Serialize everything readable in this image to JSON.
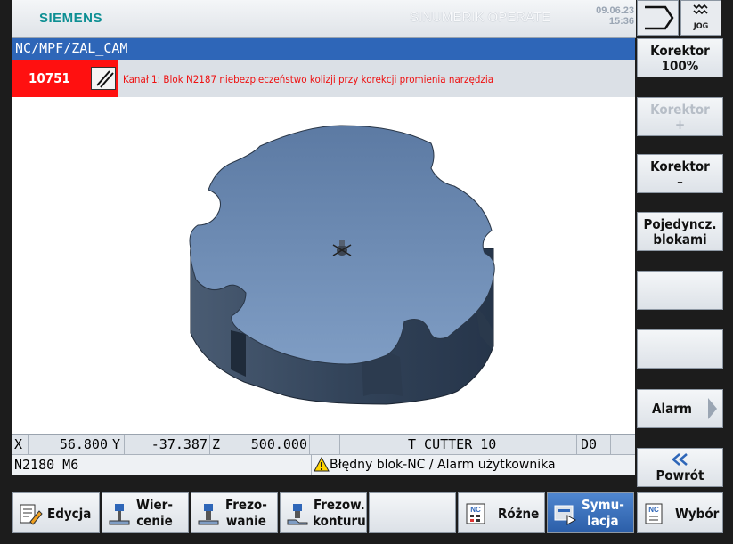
{
  "header": {
    "brand": "SIEMENS",
    "app_title": "SINUMERIK OPERATE",
    "date": "09.06.23",
    "time": "15:36",
    "jog_label": "JOG"
  },
  "program_path": "NC/MPF/ZAL_CAM",
  "alarm": {
    "number": "10751",
    "text": "Kanał 1: Blok N2187 niebezpieczeństwo kolizji przy korekcji promienia narzędzia",
    "color": "#ff1010"
  },
  "position": {
    "x_label": "X",
    "x_value": "56.800",
    "y_label": "Y",
    "y_value": "-37.387",
    "z_label": "Z",
    "z_value": "500.000",
    "tool": "T CUTTER 10",
    "d_label": "D0"
  },
  "info": {
    "block": "N2180 M6",
    "status": "Błędny blok-NC / Alarm użytkownika"
  },
  "right_softkeys": {
    "korektor_100_l1": "Korektor",
    "korektor_100_l2": "100%",
    "korektor_plus_l1": "Korektor",
    "korektor_plus_l2": "+",
    "korektor_minus_l1": "Korektor",
    "korektor_minus_l2": "–",
    "single_block_l1": "Pojedyncz.",
    "single_block_l2": "blokami",
    "alarm": "Alarm",
    "back": "Powrót"
  },
  "bottom_softkeys": {
    "edycja": "Edycja",
    "wiercenie_l1": "Wier-",
    "wiercenie_l2": "cenie",
    "frezowanie_l1": "Frezo-",
    "frezowanie_l2": "wanie",
    "frezow_konturu_l1": "Frezow.",
    "frezow_konturu_l2": "konturu",
    "rozne": "Różne",
    "symulacja_l1": "Symu-",
    "symulacja_l2": "lacja",
    "wybor": "Wybór",
    "nc_icon_text": "NC"
  },
  "colors": {
    "accent": "#2e66b8",
    "brand": "#0d8f93",
    "part_face": "#6f8fb8",
    "part_side": "#3a4b60"
  }
}
